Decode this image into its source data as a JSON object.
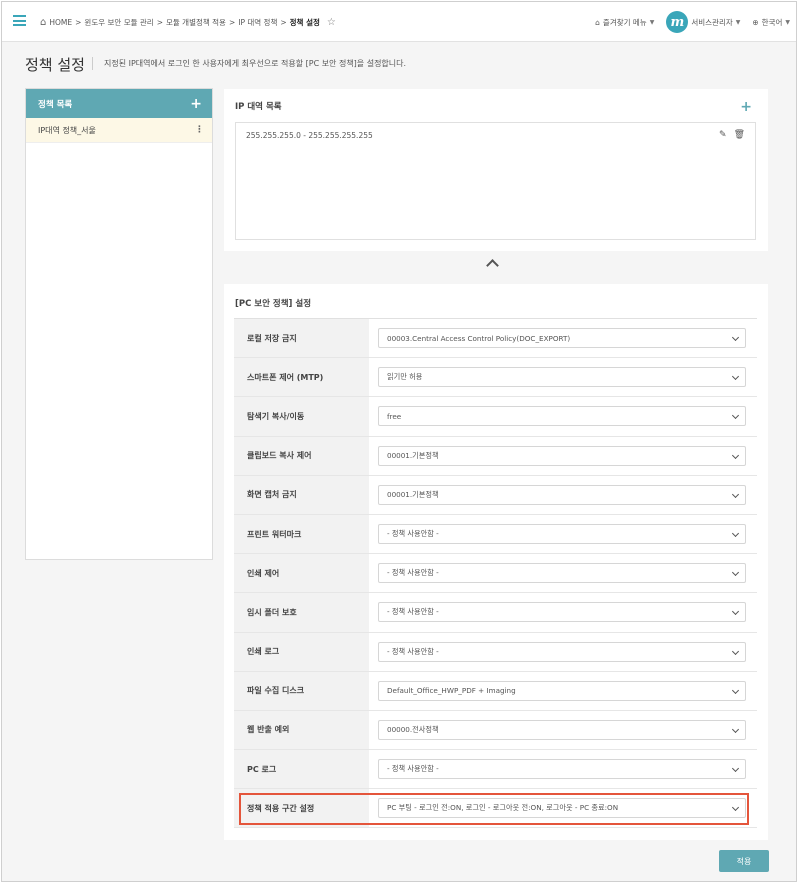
{
  "header": {
    "breadcrumb": [
      "HOME",
      ">",
      "윈도우 보안 모듈 관리",
      ">",
      "모듈 개별정책 적용",
      ">",
      "IP 대역 정책",
      ">"
    ],
    "breadcrumb_current": "정책 설정",
    "favorites_label": "즐겨찾기 메뉴",
    "avatar_letter": "m",
    "user_label": "서비스관리자",
    "language_label": "한국어"
  },
  "page": {
    "title": "정책 설정",
    "description": "지정된 IP대역에서 로그인 한 사용자에게 최우선으로 적용할 [PC 보안 정책]을 설정합니다."
  },
  "policy_list": {
    "title": "정책 목록",
    "items": [
      {
        "label": "IP대역 정책_서울"
      }
    ]
  },
  "ip_section": {
    "title": "IP 대역 목록",
    "ranges": [
      {
        "value": "255.255.255.0 - 255.255.255.255"
      }
    ]
  },
  "pc_section": {
    "title": "[PC 보안 정책] 설정",
    "rows": [
      {
        "label": "로컬 저장 금지",
        "value": "00003.Central Access Control Policy(DOC_EXPORT)"
      },
      {
        "label": "스마트폰 제어 (MTP)",
        "value": "읽기만 허용"
      },
      {
        "label": "탐색기 복사/이동",
        "value": "free"
      },
      {
        "label": "클립보드 복사 제어",
        "value": "00001.기본정책"
      },
      {
        "label": "화면 캡처 금지",
        "value": "00001.기본정책"
      },
      {
        "label": "프린트 워터마크",
        "value": "- 정책 사용안함 -"
      },
      {
        "label": "인쇄 제어",
        "value": "- 정책 사용안함 -"
      },
      {
        "label": "임시 폴더 보호",
        "value": "- 정책 사용안함 -"
      },
      {
        "label": "인쇄 로그",
        "value": "- 정책 사용안함 -"
      },
      {
        "label": "파일 수집 디스크",
        "value": "Default_Office_HWP_PDF + Imaging"
      },
      {
        "label": "웹 반출 예외",
        "value": "00000.전사정책"
      },
      {
        "label": "PC 로그",
        "value": "- 정책 사용안함 -"
      },
      {
        "label": "정책 적용 구간 설정",
        "value": "PC 부팅 - 로그인 전:ON, 로그인 - 로그아웃 전:ON, 로그아웃 - PC 종료:ON"
      }
    ]
  },
  "apply_label": "적용",
  "colors": {
    "accent": "#5fa8b3",
    "highlight": "#e4553b",
    "selected_bg": "#fdf8e6"
  }
}
